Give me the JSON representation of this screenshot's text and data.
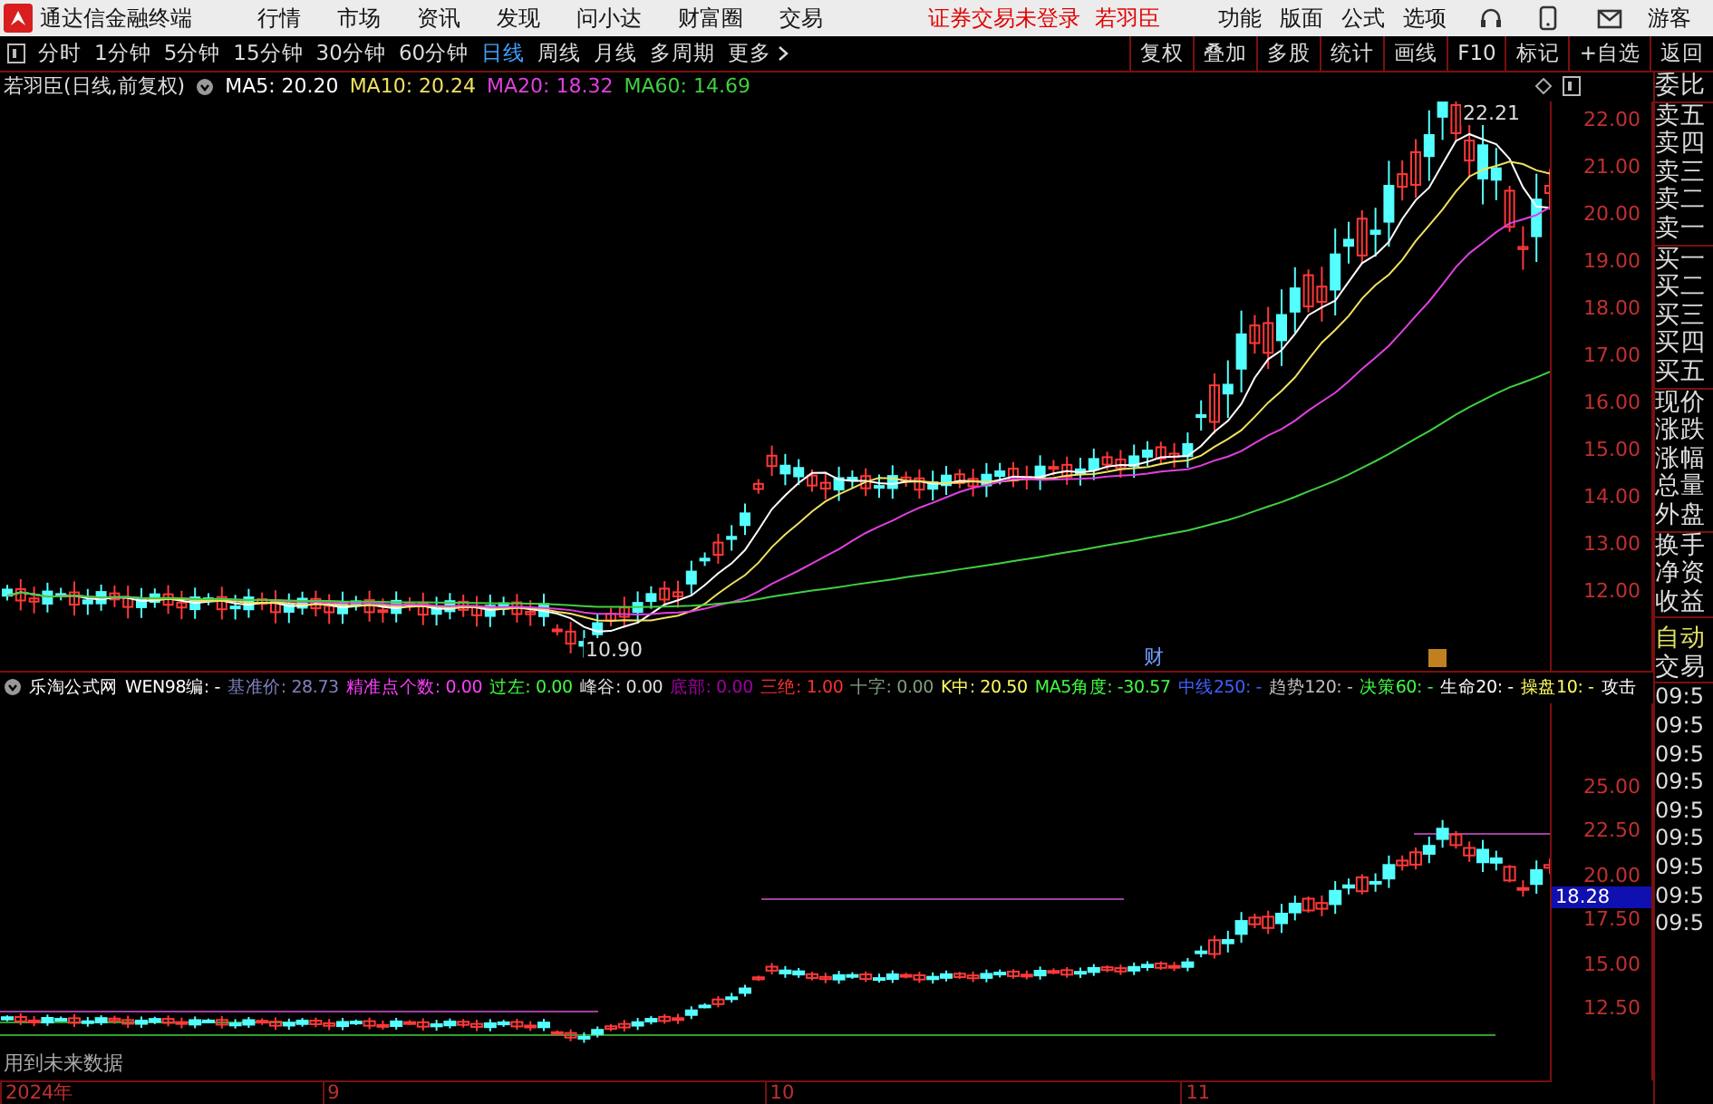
{
  "menubar": {
    "app_title": "通达信金融终端",
    "menus": [
      "行情",
      "市场",
      "资讯",
      "发现",
      "问小达",
      "财富圈",
      "交易"
    ],
    "login_status": "证券交易未登录",
    "stock_name": "若羽臣",
    "tools": [
      "功能",
      "版面",
      "公式",
      "选项"
    ],
    "user": "游客"
  },
  "toolbar": {
    "periods": [
      {
        "label": "分时",
        "selected": false
      },
      {
        "label": "1分钟",
        "selected": false
      },
      {
        "label": "5分钟",
        "selected": false
      },
      {
        "label": "15分钟",
        "selected": false
      },
      {
        "label": "30分钟",
        "selected": false
      },
      {
        "label": "60分钟",
        "selected": false
      },
      {
        "label": "日线",
        "selected": true
      },
      {
        "label": "周线",
        "selected": false
      },
      {
        "label": "月线",
        "selected": false
      },
      {
        "label": "多周期",
        "selected": false
      },
      {
        "label": "更多",
        "selected": false
      }
    ],
    "actions": [
      "复权",
      "叠加",
      "多股",
      "统计",
      "画线",
      "F10",
      "标记",
      "+自选",
      "返回"
    ]
  },
  "chart": {
    "title": "若羽臣(日线,前复权)",
    "ma": [
      {
        "label": "MA5: 20.20",
        "color": "#ffffff"
      },
      {
        "label": "MA10: 20.24",
        "color": "#f0e060"
      },
      {
        "label": "MA20: 18.32",
        "color": "#e040e0"
      },
      {
        "label": "MA60: 14.69",
        "color": "#40d040"
      }
    ],
    "price_ticks": [
      "22.00",
      "21.00",
      "20.00",
      "19.00",
      "18.00",
      "17.00",
      "16.00",
      "15.00",
      "14.00",
      "13.00",
      "12.00"
    ],
    "high_label": "22.21",
    "low_label": "10.90",
    "event_marker": "财"
  },
  "indicator": {
    "name": "乐淘公式网",
    "items": [
      {
        "label": "WEN98编: -",
        "color": "#ffffff"
      },
      {
        "label": "基准价: 28.73",
        "color": "#8080c0"
      },
      {
        "label": "精准点个数: 0.00",
        "color": "#ff40ff"
      },
      {
        "label": "过左: 0.00",
        "color": "#40ff40"
      },
      {
        "label": "峰谷: 0.00",
        "color": "#e0e0e0"
      },
      {
        "label": "底部: 0.00",
        "color": "#a000a0"
      },
      {
        "label": "三绝: 1.00",
        "color": "#ff3030"
      },
      {
        "label": "十字: 0.00",
        "color": "#80a080"
      },
      {
        "label": "K中: 20.50",
        "color": "#ffff60"
      },
      {
        "label": "MA5角度: -30.57",
        "color": "#40ff40"
      },
      {
        "label": "中线250: -",
        "color": "#4060ff"
      },
      {
        "label": "趋势120: -",
        "color": "#c0c0c0"
      },
      {
        "label": "决策60: -",
        "color": "#40ff40"
      },
      {
        "label": "生命20: -",
        "color": "#ffffff"
      },
      {
        "label": "操盘10: -",
        "color": "#ffff60"
      },
      {
        "label": "攻击",
        "color": "#ffffff"
      }
    ]
  },
  "lower_chart": {
    "price_ticks": [
      "25.00",
      "22.50",
      "20.00",
      "17.50",
      "15.00",
      "12.50"
    ],
    "current_price": "18.28",
    "note": "用到未来数据"
  },
  "date_axis": [
    "2024年",
    "9",
    "10",
    "11"
  ],
  "side_panel": {
    "quote_labels": [
      "委比",
      "卖五",
      "卖四",
      "卖三",
      "卖二",
      "卖一",
      "买一",
      "买二",
      "买三",
      "买四",
      "买五",
      "现价",
      "涨跌",
      "涨幅",
      "总量",
      "外盘",
      "换手",
      "净资",
      "收益"
    ],
    "mode": "自动",
    "trade": "交易",
    "times": [
      "09:5",
      "09:5",
      "09:5",
      "09:5",
      "09:5",
      "09:5",
      "09:5",
      "09:5",
      "09:5"
    ]
  }
}
